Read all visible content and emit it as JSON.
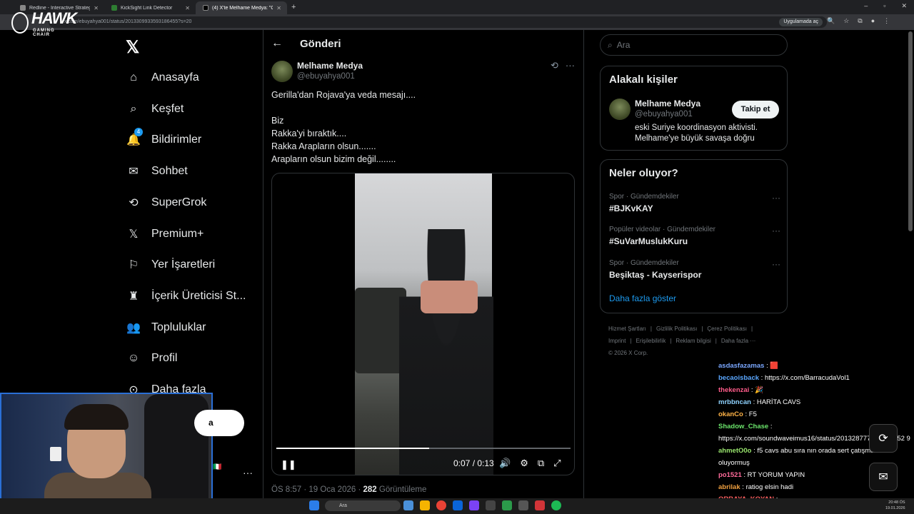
{
  "browser": {
    "tabs": [
      {
        "title": "Redline - Interactive Strategic M",
        "active": false
      },
      {
        "title": "KickSight Link Detector",
        "active": false
      },
      {
        "title": "(4) X'te Melhame Medya: \"G",
        "active": true
      }
    ],
    "url": "x.com/ebuyahya001/status/2013309933593186455?s=20",
    "app_button": "Uygulamada aç"
  },
  "overlay_logo": {
    "big": "HAWK",
    "small": "GAMING CHAIR"
  },
  "nav": {
    "items": [
      {
        "label": "Anasayfa",
        "icon": "home-icon"
      },
      {
        "label": "Keşfet",
        "icon": "search-icon"
      },
      {
        "label": "Bildirimler",
        "icon": "bell-icon",
        "badge": "4"
      },
      {
        "label": "Sohbet",
        "icon": "mail-icon"
      },
      {
        "label": "SuperGrok",
        "icon": "grok-icon"
      },
      {
        "label": "Premium+",
        "icon": "x-icon"
      },
      {
        "label": "Yer İşaretleri",
        "icon": "bookmark-icon"
      },
      {
        "label": "İçerik Üreticisi St...",
        "icon": "creator-icon"
      },
      {
        "label": "Topluluklar",
        "icon": "communities-icon"
      },
      {
        "label": "Profil",
        "icon": "profile-icon"
      },
      {
        "label": "Daha fazla",
        "icon": "more-icon"
      }
    ],
    "post_button": "a"
  },
  "post": {
    "header_title": "Gönderi",
    "author_name": "Melhame Medya",
    "author_handle": "@ebuyahya001",
    "text_lines": [
      "Gerilla'dan Rojava'ya veda mesajı....",
      "Biz",
      "Rakka'yi bıraktık....",
      "Rakka Arapların olsun.......",
      "Arapların olsun bizim değil........"
    ],
    "video": {
      "time": "0:07 / 0:13",
      "progress": 0.52
    },
    "meta_time": "ÖS 8:57 · 19 Oca 2026 · ",
    "meta_views_count": "282",
    "meta_views_label": " Görüntüleme"
  },
  "right": {
    "search_placeholder": "Ara",
    "related": {
      "title": "Alakalı kişiler",
      "name": "Melhame Medya",
      "handle": "@ebuyahya001",
      "follow_label": "Takip et",
      "bio_line1": "eski Suriye koordinasyon aktivisti.",
      "bio_line2": "Melhame'ye büyük savaşa doğru"
    },
    "trends": {
      "title": "Neler oluyor?",
      "items": [
        {
          "category": "Spor · Gündemdekiler",
          "name": "#BJKvKAY"
        },
        {
          "category": "Popüler videolar · Gündemdekiler",
          "name": "#SuVarMuslukKuru"
        },
        {
          "category": "Spor · Gündemdekiler",
          "name": "Beşiktaş - Kayserispor"
        }
      ],
      "show_more": "Daha fazla göster"
    },
    "footer": {
      "links": [
        "Hizmet Şartları",
        "|",
        "Gizlilik Politikası",
        "|",
        "Çerez Politikası",
        "|",
        "Imprint",
        "|",
        "Erişilebilirlik",
        "|",
        "Reklam bilgisi",
        "|",
        "Daha fazla ···"
      ],
      "copyright": "© 2026 X Corp."
    }
  },
  "chat": {
    "messages": [
      {
        "user": "asdasfazamas",
        "text": " 🟥",
        "color": "#7aa7ff"
      },
      {
        "user": "becaoisback",
        "text": "https://x.com/BarracudaVol1",
        "color": "#5aa7ff"
      },
      {
        "user": "thekenzai",
        "text": " 🎉",
        "color": "#ff5c8a"
      },
      {
        "user": "mrbbncan",
        "text": "HARİTA CAVS",
        "color": "#8fd3ff"
      },
      {
        "user": "okanCo",
        "text": "F5",
        "color": "#ffb347"
      },
      {
        "user": "Shadow_Chase",
        "text": "",
        "color": "#6be56b"
      },
      {
        "user": "",
        "text": "https://x.com/soundwaveimus16/status/201328777108378052 9",
        "color": "#ffffff"
      },
      {
        "user": "ahmetO0o",
        "text": "f5 cavs abu sıra nın orada sert çatışmalar oluyormuş",
        "color": "#9ae66e"
      },
      {
        "user": "po1521",
        "text": "RT YORUM YAPIN",
        "color": "#ff6b9a"
      },
      {
        "user": "abrilak",
        "text": "ratiog elsin hadi",
        "color": "#f0a040"
      },
      {
        "user": "ORBAYA_KOYAN",
        "text": "",
        "color": "#ff6060"
      }
    ]
  },
  "stream": {
    "flag": "🇮🇹"
  },
  "taskbar": {
    "search": "Ara",
    "clock_time": "20:48 ÖS",
    "clock_date": "19.01.2026"
  }
}
